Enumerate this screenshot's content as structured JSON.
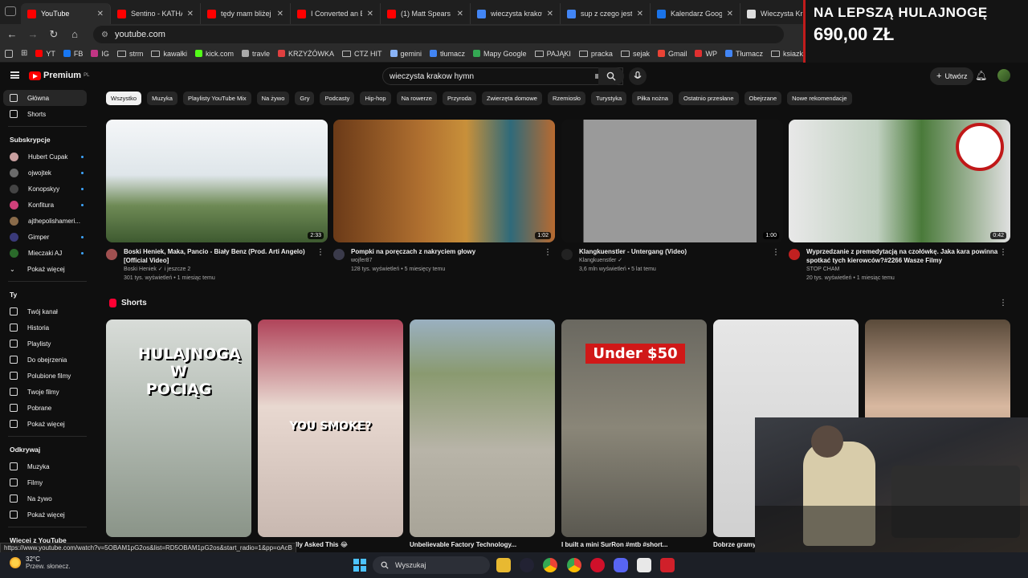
{
  "browser": {
    "tabs": [
      {
        "title": "YouTube",
        "color": "#ff0000",
        "active": true
      },
      {
        "title": "Sentino - KATHAR",
        "color": "#ff0000"
      },
      {
        "title": "tędy mam bliżej -",
        "color": "#ff0000"
      },
      {
        "title": "I Converted an Ele",
        "color": "#ff0000"
      },
      {
        "title": "(1) Matt Spears -",
        "color": "#ff0000"
      },
      {
        "title": "wieczysta krakow",
        "color": "#4285f4"
      },
      {
        "title": "sup z czego jest z",
        "color": "#4285f4"
      },
      {
        "title": "Kalendarz Google",
        "color": "#1a73e8"
      },
      {
        "title": "Wieczysta Kraków",
        "color": "#dddddd"
      }
    ],
    "url": "youtube.com",
    "bookmarks": [
      {
        "label": "YT",
        "kind": "yt"
      },
      {
        "label": "FB",
        "kind": "fb"
      },
      {
        "label": "IG",
        "kind": "ig"
      },
      {
        "label": "strm",
        "kind": "folder"
      },
      {
        "label": "kawałki",
        "kind": "folder"
      },
      {
        "label": "kick.com",
        "kind": "kick"
      },
      {
        "label": "travle",
        "kind": "globe"
      },
      {
        "label": "KRZYŻÓWKA",
        "kind": "red"
      },
      {
        "label": "CTZ HIT",
        "kind": "folder"
      },
      {
        "label": "gemini",
        "kind": "gemini"
      },
      {
        "label": "tłumacz",
        "kind": "tr"
      },
      {
        "label": "Mapy Google",
        "kind": "maps"
      },
      {
        "label": "PAJĄKI",
        "kind": "folder"
      },
      {
        "label": "pracka",
        "kind": "folder"
      },
      {
        "label": "sejak",
        "kind": "folder"
      },
      {
        "label": "Gmail",
        "kind": "gmail"
      },
      {
        "label": "WP",
        "kind": "wp"
      },
      {
        "label": "Tłumacz",
        "kind": "tr"
      },
      {
        "label": "ksiazka",
        "kind": "folder"
      }
    ]
  },
  "promo": {
    "line1": "NA LEPSZĄ HULAJNOGĘ",
    "line2": "690,00 ZŁ"
  },
  "header": {
    "logo": "Premium",
    "logo_sup": "PL",
    "search_value": "wieczysta krakow hymn",
    "create_label": "Utwórz"
  },
  "sidebar": {
    "main": [
      {
        "label": "Główna",
        "active": true
      },
      {
        "label": "Shorts"
      }
    ],
    "subs_title": "Subskrypcje",
    "subs": [
      {
        "label": "Hubert Cupak",
        "color": "#c9a0a0"
      },
      {
        "label": "ojwojtek",
        "color": "#6b6b6b"
      },
      {
        "label": "Konopskyy",
        "color": "#444"
      },
      {
        "label": "Konfitura",
        "color": "#d0407a"
      },
      {
        "label": "ajthepolishameri...",
        "color": "#8a6b4a"
      },
      {
        "label": "Gimper",
        "color": "#3a3a7a"
      },
      {
        "label": "Mieczaki AJ",
        "color": "#2a6a2a"
      }
    ],
    "subs_more": "Pokaż więcej",
    "you_title": "Ty",
    "you": [
      "Twój kanał",
      "Historia",
      "Playlisty",
      "Do obejrzenia",
      "Polubione filmy",
      "Twoje filmy",
      "Pobrane",
      "Pokaż więcej"
    ],
    "explore_title": "Odkrywaj",
    "explore": [
      "Muzyka",
      "Filmy",
      "Na żywo",
      "Pokaż więcej"
    ],
    "more_title": "Więcej z YouTube"
  },
  "chips": [
    "Wszystko",
    "Muzyka",
    "Playlisty YouTube Mix",
    "Na żywo",
    "Gry",
    "Podcasty",
    "Hip-hop",
    "Na rowerze",
    "Przyroda",
    "Zwierzęta domowe",
    "Rzemiosło",
    "Turystyka",
    "Piłka nożna",
    "Ostatnio przesłane",
    "Obejrzane",
    "Nowe rekomendacje"
  ],
  "videos": [
    {
      "title": "Boski Heniek, Maka, Pancio - Biały Benz (Prod. Arti Angelo) [Official Video]",
      "channel": "Boski Heniek ✓ i jeszcze 2",
      "stats": "301 tys. wyświetleń • 1 miesiąc temu",
      "duration": "2:33",
      "channel_color": "#a05050"
    },
    {
      "title": "Pompki na poręczach z nakryciem głowy",
      "channel": "wojfer87",
      "stats": "128 tys. wyświetleń • 5 miesięcy temu",
      "duration": "1:02",
      "channel_color": "#3a3a4a"
    },
    {
      "title": "Klangkuenstler - Untergang (Video)",
      "channel": "Klangkuenstler ✓",
      "stats": "3,6 mln wyświetleń • 5 lat temu",
      "duration": "1:00",
      "channel_color": "#222"
    },
    {
      "title": "Wyprzedzanie z premedytacją na czołówkę. Jaka kara powinna spotkać tych kierowców?#2266 Wasze Filmy",
      "channel": "STOP CHAM",
      "stats": "20 tys. wyświetleń • 1 miesiąc temu",
      "duration": "0:42",
      "channel_color": "#c02020"
    }
  ],
  "shorts": {
    "title": "Shorts",
    "items": [
      {
        "title": "",
        "overlay": "HULAJNOGĄ W POCIĄG"
      },
      {
        "title": "lly Asked This 😂",
        "overlay": "YOU SMOKE?"
      },
      {
        "title": "Unbelievable Factory Technology...",
        "overlay": ""
      },
      {
        "title": "I built a mini SurRon #mtb #short...",
        "overlay": "Under $50"
      },
      {
        "title": "Dobrze gramy",
        "overlay": ""
      },
      {
        "title": "",
        "overlay": ""
      }
    ]
  },
  "status_url": "https://www.youtube.com/watch?v=5OBAM1pG2os&list=RD5OBAM1pG2os&start_radio=1&pp=oAcB",
  "taskbar": {
    "temp": "32°C",
    "weather": "Przew. słonecz.",
    "search": "Wyszukaj"
  }
}
